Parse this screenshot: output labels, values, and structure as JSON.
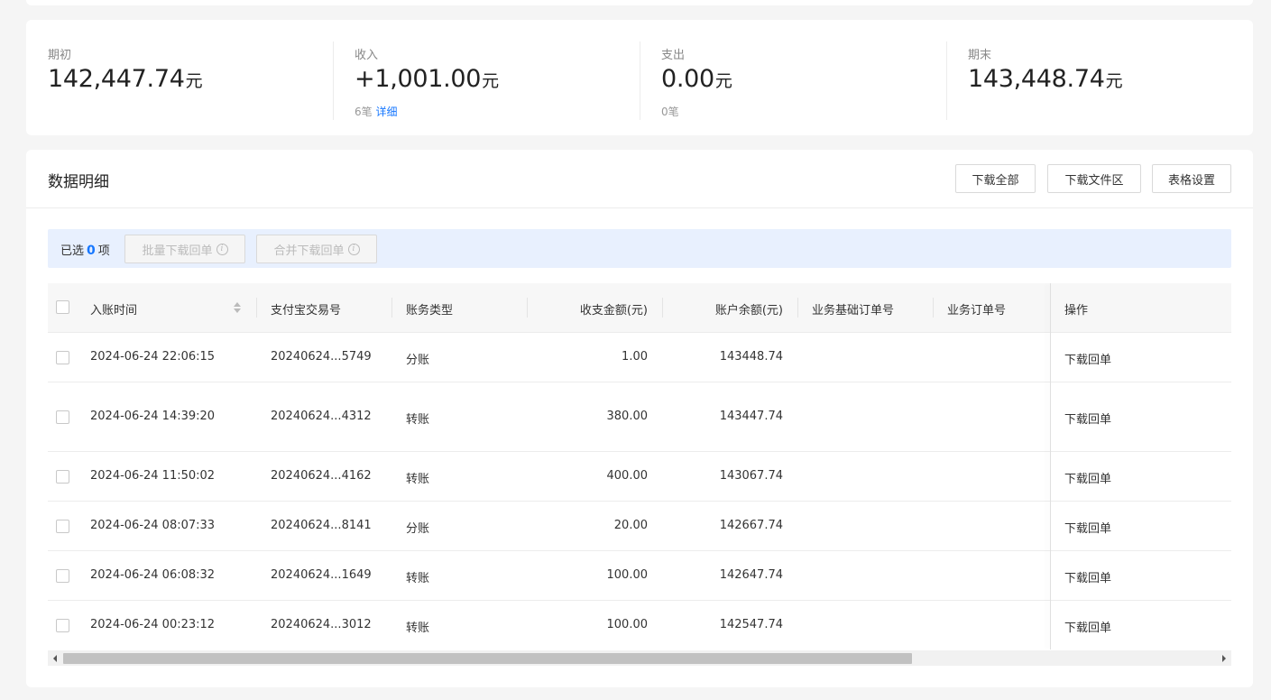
{
  "summary": {
    "opening": {
      "label": "期初",
      "amount": "142,447.74",
      "unit": "元"
    },
    "income": {
      "label": "收入",
      "amount": "+1,001.00",
      "unit": "元",
      "count": "6笔",
      "detail_link": "详细"
    },
    "expense": {
      "label": "支出",
      "amount": "0.00",
      "unit": "元",
      "count": "0笔"
    },
    "closing": {
      "label": "期末",
      "amount": "143,448.74",
      "unit": "元"
    }
  },
  "details": {
    "title": "数据明细",
    "buttons": {
      "download_all": "下载全部",
      "download_area": "下载文件区",
      "table_settings": "表格设置"
    }
  },
  "selection": {
    "prefix": "已选",
    "count": "0",
    "suffix": "项",
    "batch_download": "批量下载回单",
    "merge_download": "合并下载回单"
  },
  "table": {
    "columns": [
      "入账时间",
      "支付宝交易号",
      "账务类型",
      "收支金额(元)",
      "账户余额(元)",
      "业务基础订单号",
      "业务订单号",
      "操作"
    ],
    "rows": [
      {
        "time": "2024-06-24 22:06:15",
        "trade_no": "20240624...5749",
        "type": "分账",
        "amount": "1.00",
        "balance": "143448.74",
        "base_order": "",
        "order": "",
        "action": "下载回单"
      },
      {
        "time": "2024-06-24 14:39:20",
        "trade_no": "20240624...4312",
        "type": "转账",
        "amount": "380.00",
        "balance": "143447.74",
        "base_order": "",
        "order": "",
        "action": "下载回单"
      },
      {
        "time": "2024-06-24 11:50:02",
        "trade_no": "20240624...4162",
        "type": "转账",
        "amount": "400.00",
        "balance": "143067.74",
        "base_order": "",
        "order": "",
        "action": "下载回单"
      },
      {
        "time": "2024-06-24 08:07:33",
        "trade_no": "20240624...8141",
        "type": "分账",
        "amount": "20.00",
        "balance": "142667.74",
        "base_order": "",
        "order": "",
        "action": "下载回单"
      },
      {
        "time": "2024-06-24 06:08:32",
        "trade_no": "20240624...1649",
        "type": "转账",
        "amount": "100.00",
        "balance": "142647.74",
        "base_order": "",
        "order": "",
        "action": "下载回单"
      },
      {
        "time": "2024-06-24 00:23:12",
        "trade_no": "20240624...3012",
        "type": "转账",
        "amount": "100.00",
        "balance": "142547.74",
        "base_order": "",
        "order": "",
        "action": "下载回单"
      }
    ]
  },
  "colors": {
    "link": "#1677ff",
    "selection_bar": "#e8f0fe"
  }
}
